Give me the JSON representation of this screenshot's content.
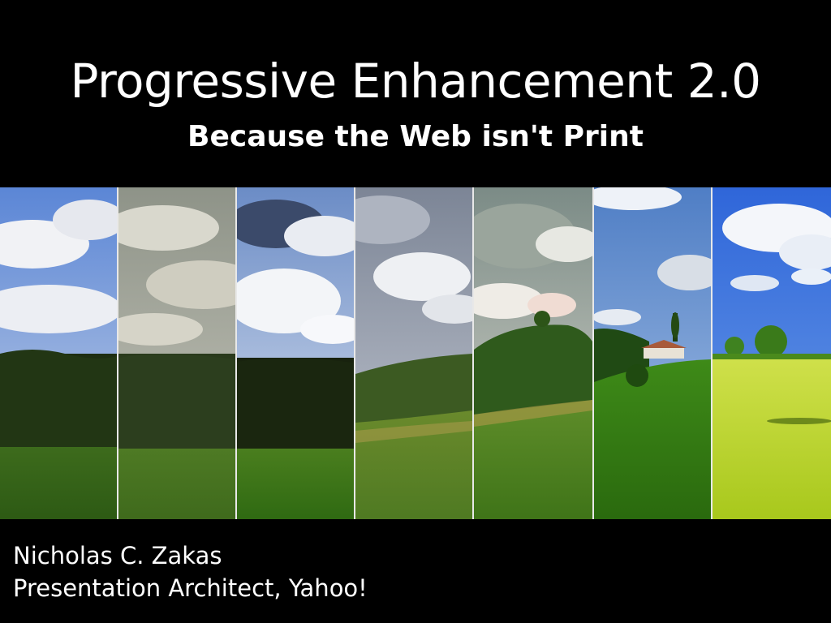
{
  "slide": {
    "title": "Progressive Enhancement 2.0",
    "subtitle": "Because the Web isn't Print",
    "author": "Nicholas C. Zakas",
    "role": "Presentation Architect, Yahoo!"
  },
  "image": {
    "icon": "landscape-panels-image",
    "palette": {
      "divider": "#e8e8e8",
      "sky_blue": "#3a6fd8",
      "grass_bright": "#b8d420",
      "forest_dark": "#1e2a12"
    }
  }
}
